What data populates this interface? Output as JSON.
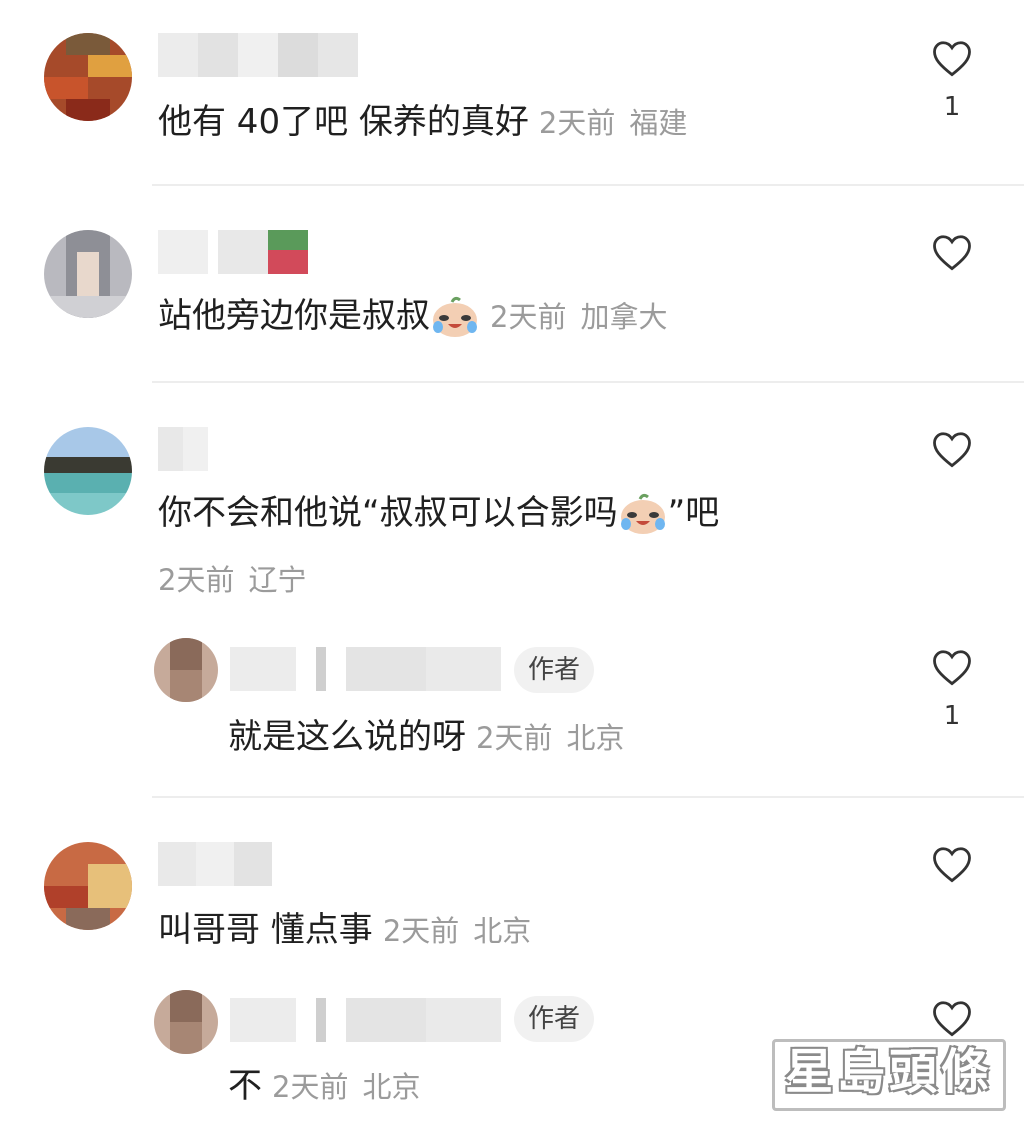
{
  "comments": [
    {
      "text": "他有 40了吧 保养的真好",
      "time": "2天前",
      "location": "福建",
      "likes": "1"
    },
    {
      "text": "站他旁边你是叔叔",
      "time": "2天前",
      "location": "加拿大",
      "likes": ""
    },
    {
      "text_before": "你不会和他说“叔叔可以合影吗",
      "text_after": "”吧",
      "time": "2天前",
      "location": "辽宁",
      "likes": "",
      "reply": {
        "badge": "作者",
        "text": "就是这么说的呀",
        "time": "2天前",
        "location": "北京",
        "likes": "1"
      }
    },
    {
      "text": "叫哥哥 懂点事",
      "time": "2天前",
      "location": "北京",
      "likes": "",
      "reply": {
        "badge": "作者",
        "text": "不",
        "time": "2天前",
        "location": "北京",
        "likes": ""
      }
    }
  ],
  "watermark": "星島頭條",
  "icons": {
    "like": "heart-icon",
    "emoji": "laugh-cry-emoji-icon"
  }
}
